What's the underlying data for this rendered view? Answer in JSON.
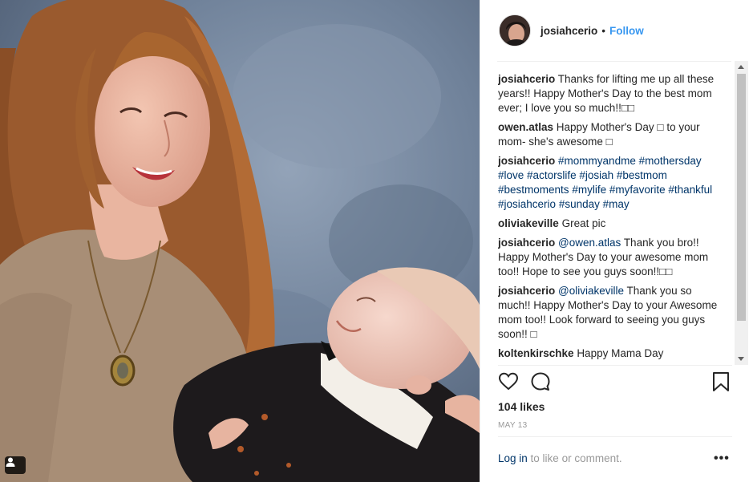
{
  "post": {
    "author": "josiahcerio",
    "separator": "•",
    "follow_label": "Follow"
  },
  "comments": [
    {
      "user": "josiahcerio",
      "text": "Thanks for lifting me up all these years!! Happy Mother's Day to the best mom ever; I love you so much!!□□"
    },
    {
      "user": "owen.atlas",
      "text": "Happy Mother's Day □ to your mom- she's awesome □"
    },
    {
      "user": "josiahcerio",
      "hashtags": [
        "#mommyandme",
        "#mothersday",
        "#love",
        "#actorslife",
        "#josiah",
        "#bestmom",
        "#bestmoments",
        "#mylife",
        "#myfavorite",
        "#thankful",
        "#josiahcerio",
        "#sunday",
        "#may"
      ]
    },
    {
      "user": "oliviakeville",
      "text": "Great pic"
    },
    {
      "user": "josiahcerio",
      "mention": "@owen.atlas",
      "text": "Thank you bro!! Happy Mother's Day to your awesome mom too!! Hope to see you guys soon!!□□"
    },
    {
      "user": "josiahcerio",
      "mention": "@oliviakeville",
      "text": "Thank you so much!! Happy Mother's Day to your Awesome mom too!! Look forward to seeing you guys soon!! □"
    },
    {
      "user": "koltenkirschke",
      "text": "Happy Mama Day"
    }
  ],
  "stats": {
    "likes": "104 likes",
    "date": "MAY 13"
  },
  "footer": {
    "login_link": "Log in",
    "login_suffix": " to like or comment.",
    "more_label": "•••"
  },
  "icons": {
    "like": "heart-icon",
    "comment": "comment-bubble-icon",
    "save": "bookmark-icon",
    "tagged": "person-tag-icon",
    "more": "more-options-icon"
  },
  "colors": {
    "link": "#3897f0",
    "hashtag": "#003569",
    "muted": "#999999",
    "text": "#262626"
  }
}
